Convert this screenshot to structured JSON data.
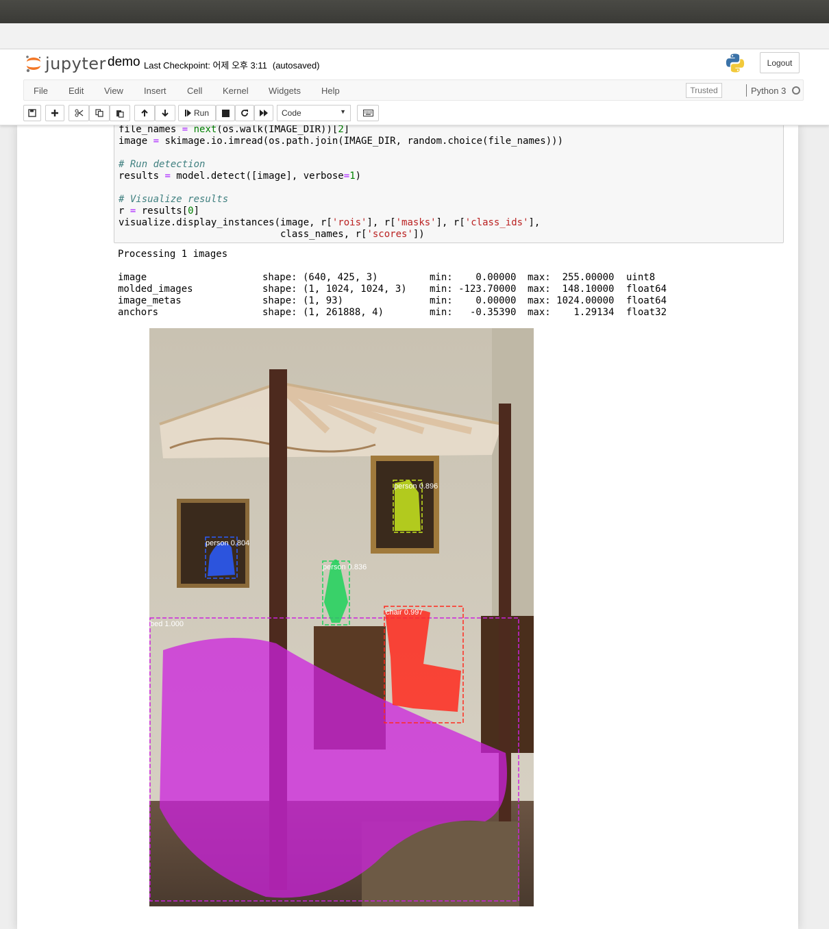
{
  "header": {
    "logo_text": "jupyter",
    "notebook_name": "demo",
    "checkpoint_label": "Last Checkpoint: 어제 오후 3:11",
    "autosaved": "(autosaved)",
    "logout_label": "Logout"
  },
  "menubar": {
    "items": [
      "File",
      "Edit",
      "View",
      "Insert",
      "Cell",
      "Kernel",
      "Widgets",
      "Help"
    ],
    "trusted": "Trusted",
    "kernel_name": "Python 3"
  },
  "toolbar": {
    "run_label": "Run",
    "cell_type": "Code"
  },
  "code": {
    "lines": [
      "file_names = next(os.walk(IMAGE_DIR))[2]",
      "image = skimage.io.imread(os.path.join(IMAGE_DIR, random.choice(file_names)))",
      "",
      "# Run detection",
      "results = model.detect([image], verbose=1)",
      "",
      "# Visualize results",
      "r = results[0]",
      "visualize.display_instances(image, r['rois'], r['masks'], r['class_ids'],",
      "                            class_names, r['scores'])"
    ]
  },
  "output": {
    "header": "Processing 1 images",
    "rows": [
      {
        "name": "image",
        "shape": "shape: (640, 425, 3)",
        "min": "min:    0.00000",
        "max": "max:  255.00000",
        "dtype": "uint8"
      },
      {
        "name": "molded_images",
        "shape": "shape: (1, 1024, 1024, 3)",
        "min": "min: -123.70000",
        "max": "max:  148.10000",
        "dtype": "float64"
      },
      {
        "name": "image_metas",
        "shape": "shape: (1, 93)",
        "min": "min:    0.00000",
        "max": "max: 1024.00000",
        "dtype": "float64"
      },
      {
        "name": "anchors",
        "shape": "shape: (1, 261888, 4)",
        "min": "min:   -0.35390",
        "max": "max:    1.29134",
        "dtype": "float32"
      }
    ]
  },
  "detections": [
    {
      "label": "person 0.896",
      "color": "#c8e61e"
    },
    {
      "label": "person 0.804",
      "color": "#2a5cff"
    },
    {
      "label": "person 0.836",
      "color": "#1ed25a"
    },
    {
      "label": "chair 0.997",
      "color": "#ff2a1e"
    },
    {
      "label": "bed 1.000",
      "color": "#cc22dd"
    }
  ]
}
